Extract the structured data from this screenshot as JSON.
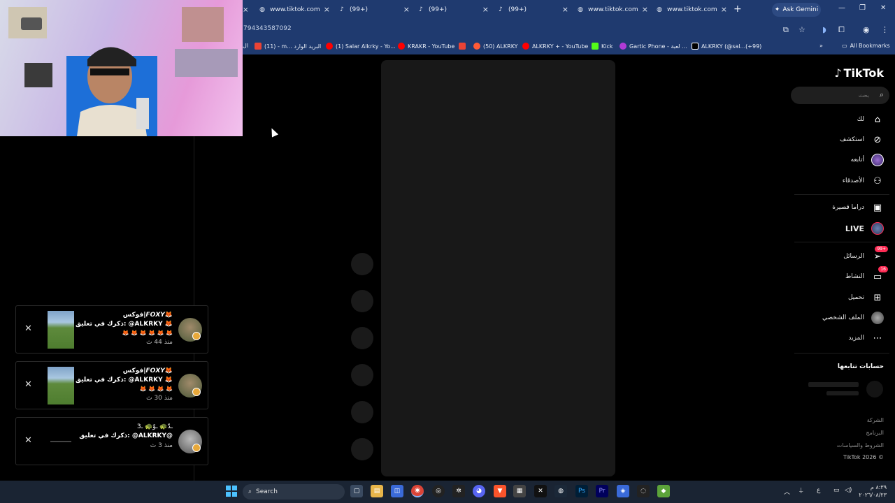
{
  "browser": {
    "tabs": [
      {
        "label": "www.tiktok.com",
        "icon": "globe-icon"
      },
      {
        "label": "(99+)",
        "icon": "tiktok-icon"
      },
      {
        "label": "(99+)",
        "icon": "tiktok-icon"
      },
      {
        "label": "(99+)",
        "icon": "tiktok-icon"
      },
      {
        "label": "www.tiktok.com",
        "icon": "globe-icon"
      },
      {
        "label": "www.tiktok.com",
        "icon": "globe-icon"
      }
    ],
    "ask_gemini": "Ask Gemini",
    "url_fragment": "794343587092",
    "bookmarks": [
      {
        "label": "(11) - m... البريد الوارد",
        "color": "#ea4335"
      },
      {
        "label": "(1) Salar Alkrky - Yo...",
        "color": "#ff0000"
      },
      {
        "label": "KRAKR - YouTube",
        "color": "#ff0000"
      },
      {
        "label": "",
        "color": "#ea4335"
      },
      {
        "label": "(50) ALKRKY",
        "color": "#ff5a36"
      },
      {
        "label": "ALKRKY + - YouTube",
        "color": "#ff0000"
      },
      {
        "label": "Kick",
        "color": "#53fc18"
      },
      {
        "label": "Gartic Phone - لعبة ...",
        "color": "#b13bd6"
      },
      {
        "label": "ALKRKY (@sal...(+99)",
        "color": "#ffffff"
      }
    ],
    "all_bookmarks": "All Bookmarks"
  },
  "notifications": [
    {
      "name": "فوكس|𝙁𝙊𝙓𝙔🦊",
      "message": "ذكرك في تعليق: @ALKRKY 🦊",
      "emojis": "🦊 🦊 🦊 🦊 🦊 🦊",
      "time": "منذ 44 ث"
    },
    {
      "name": "فوكس|𝙁𝙊𝙓𝙔🦊",
      "message": "ذكرك في تعليق: @ALKRKY 🦊",
      "emojis": "🦊 🦊 🦊 🦊",
      "time": "منذ 30 ث"
    },
    {
      "name": "ـدّ🐢 ـوّ🐢 ـ3",
      "message": "ذكرك في تعليق: @ALKRKY@",
      "emojis": "",
      "time": "منذ 3 ث"
    }
  ],
  "tiktok": {
    "logo": "TikTok",
    "search_placeholder": "بحث",
    "nav": [
      {
        "label": "لك",
        "icon": "home-icon"
      },
      {
        "label": "استكشف",
        "icon": "compass-icon"
      },
      {
        "label": "أتابعه",
        "icon": "following-avatar"
      },
      {
        "label": "الأصدقاء",
        "icon": "friends-icon"
      }
    ],
    "nav2": [
      {
        "label": "دراما قصيرة",
        "icon": "drama-icon"
      },
      {
        "label": "LIVE",
        "icon": "live-avatar"
      }
    ],
    "nav3": [
      {
        "label": "الرسائل",
        "icon": "messages-icon",
        "badge": "99+"
      },
      {
        "label": "النشاط",
        "icon": "activity-icon",
        "badge": "16"
      },
      {
        "label": "تحميل",
        "icon": "upload-icon",
        "badge": ""
      },
      {
        "label": "الملف الشخصي",
        "icon": "profile-avatar",
        "badge": ""
      },
      {
        "label": "المزيد",
        "icon": "more-icon",
        "badge": ""
      }
    ],
    "following_title": "حسابات تتابعها",
    "footer": [
      "الشركة",
      "البرنامج",
      "الشروط والسياسات",
      "TikTok 2026 ©"
    ]
  },
  "taskbar": {
    "search": "Search",
    "clock_time": "٨:٣٩ م",
    "clock_date": "٢٠٢٦/٠٨/٢٣",
    "lang": "ع"
  }
}
